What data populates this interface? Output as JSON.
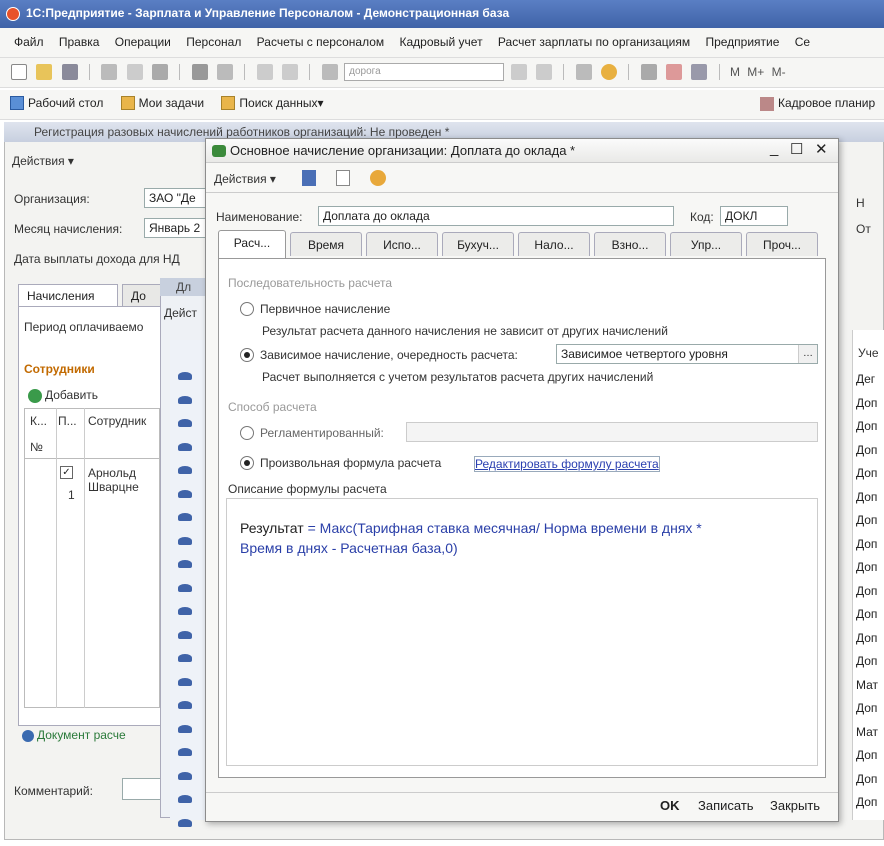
{
  "app": {
    "title": "1С:Предприятие - Зарплата и Управление Персоналом - Демонстрационная база"
  },
  "menu": [
    "Файл",
    "Правка",
    "Операции",
    "Персонал",
    "Расчеты с персоналом",
    "Кадровый учет",
    "Расчет зарплаты по организациям",
    "Предприятие",
    "Се"
  ],
  "toolbar": {
    "search_placeholder": "дорога",
    "btn_m": "М",
    "btn_mplus": "М+",
    "btn_mminus": "М-"
  },
  "quickbar": {
    "desktop": "Рабочий стол",
    "tasks": "Мои задачи",
    "search": "Поиск данных",
    "hr": "Кадровое планир"
  },
  "bg_doc": {
    "title": "Регистрация разовых начислений работников организаций: Не проведен *",
    "actions": "Действия",
    "org_label": "Организация:",
    "org_value": "ЗАО \"Де",
    "month_label": "Месяц начисления:",
    "month_value": "Январь 2",
    "date_label": "Дата выплаты дохода для НД",
    "tab_accruals": "Начисления",
    "tab_2": "До",
    "period_label": "Период оплачиваемо",
    "employees_label": "Сотрудники",
    "add_label": "Добавить",
    "col_k": "К...",
    "col_p": "П...",
    "col_emp": "Сотрудник",
    "col_no": "№",
    "row_name": "Арнольд Шварцне",
    "row_no": "1",
    "doc_calc": "Документ расче",
    "comment_label": "Комментарий:"
  },
  "mid_win": {
    "title": "Дл",
    "actions": "Дейст"
  },
  "right_col": {
    "header": "Уче",
    "items": [
      "Дег",
      "Доп",
      "Доп",
      "Доп",
      "Доп",
      "Доп",
      "Доп",
      "Доп",
      "Доп",
      "Доп",
      "Доп",
      "Доп",
      "Доп",
      "Мат",
      "Доп",
      "Мат",
      "Доп",
      "Доп",
      "Доп"
    ]
  },
  "dialog": {
    "title": "Основное начисление организации: Доплата до оклада *",
    "actions": "Действия",
    "name_label": "Наименование:",
    "name_value": "Доплата до оклада",
    "code_label": "Код:",
    "code_value": "ДОКЛ",
    "tabs": [
      "Расч...",
      "Время",
      "Испо...",
      "Бухуч...",
      "Нало...",
      "Взно...",
      "Упр...",
      "Проч..."
    ],
    "seq_section": "Последовательность расчета",
    "primary_label": "Первичное начисление",
    "primary_desc": "Результат расчета данного начисления не зависит от других начислений",
    "dependent_label": "Зависимое начисление, очередность расчета:",
    "dependent_value": "Зависимое четвертого уровня",
    "dependent_desc": "Расчет выполняется с учетом результатов расчета других начислений",
    "method_section": "Способ расчета",
    "regulated_label": "Регламентированный:",
    "arbitrary_label": "Произвольная формула расчета",
    "edit_formula_link": "Редактировать формулу расчета",
    "formula_section": "Описание формулы расчета",
    "formula_result": "Результат",
    "formula_eq": "=",
    "formula_body": "Макс(Тарифная ставка месячная/ Норма времени в днях *",
    "formula_line2": "Время в днях - Расчетная база,0)",
    "ok": "OK",
    "save": "Записать",
    "close": "Закрыть"
  },
  "colors": {
    "title_bar": "#4a6fb6",
    "link": "#2a3fb0",
    "formula_text": "#2a3fa8",
    "employees_label": "#c26a00"
  }
}
